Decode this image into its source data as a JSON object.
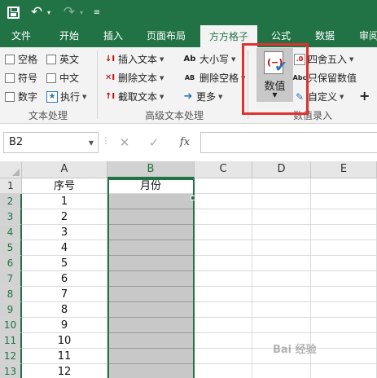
{
  "qat": {
    "undo": "↶",
    "redo": "↷",
    "dropdown": "▾",
    "more": "≡"
  },
  "tabs": [
    "文件",
    "开始",
    "插入",
    "页面布局",
    "方方格子",
    "公式",
    "数据",
    "审阅"
  ],
  "ribbon": {
    "text_group": {
      "label": "文本处理",
      "items": [
        "空格",
        "英文",
        "符号",
        "中文",
        "数字",
        "执行"
      ]
    },
    "adv_group": {
      "label": "高级文本处理",
      "items": [
        "插入文本",
        "删除文本",
        "截取文本",
        "大小写",
        "删除空格",
        "更多"
      ]
    },
    "entry_group": {
      "label": "数值录入",
      "big_button": "数值",
      "items": [
        "四舍五入",
        "只保留数值",
        "自定义",
        "+"
      ]
    }
  },
  "formula_bar": {
    "name_box": "B2",
    "cancel": "✕",
    "enter": "✓",
    "fx": "fx",
    "value": ""
  },
  "sheet": {
    "columns": [
      "A",
      "B",
      "C",
      "D",
      "E"
    ],
    "rows": [
      "1",
      "2",
      "3",
      "4",
      "5",
      "6",
      "7",
      "8",
      "9",
      "10",
      "11",
      "12",
      "13"
    ],
    "col_a": [
      "序号",
      "1",
      "2",
      "3",
      "4",
      "5",
      "6",
      "7",
      "8",
      "9",
      "10",
      "11",
      "12"
    ],
    "col_b_header": "月份"
  },
  "watermark": "Bai 经验"
}
